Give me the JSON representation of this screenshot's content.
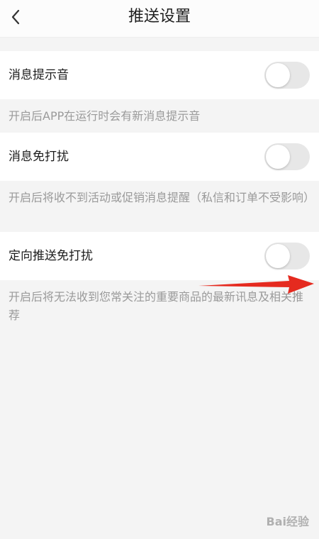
{
  "header": {
    "title": "推送设置",
    "back_icon": "chevron-left-icon"
  },
  "settings": [
    {
      "label": "消息提示音",
      "enabled": false,
      "description": "开启后APP在运行时会有新消息提示音"
    },
    {
      "label": "消息免打扰",
      "enabled": false,
      "description": "开启后将收不到活动或促销消息提醒（私信和订单不受影响）"
    },
    {
      "label": "定向推送免打扰",
      "enabled": false,
      "description": "开启后将无法收到您常关注的重要商品的最新讯息及相关推荐"
    }
  ],
  "annotation": {
    "arrow_color": "#e52a1f"
  },
  "watermark": {
    "text": "Bai经验"
  }
}
